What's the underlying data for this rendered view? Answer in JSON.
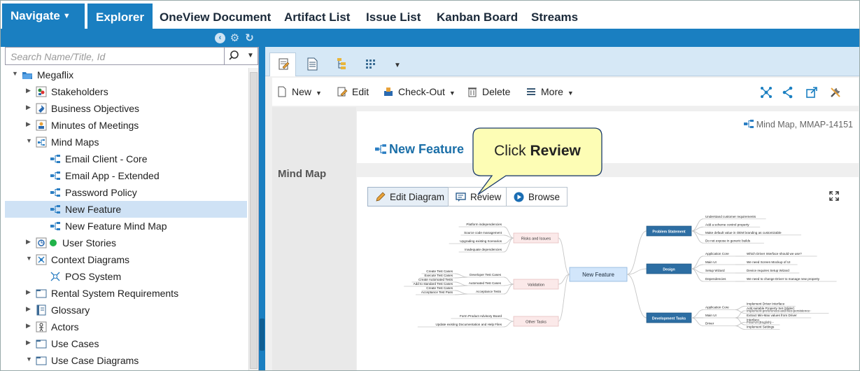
{
  "topnav": {
    "navigate": "Navigate",
    "tabs": [
      "Explorer",
      "OneView Document",
      "Artifact List",
      "Issue List",
      "Kanban Board",
      "Streams"
    ]
  },
  "search": {
    "placeholder": "Search Name/Title, Id"
  },
  "tree": [
    {
      "label": "Megaflix",
      "depth": 0,
      "arrow": "down",
      "icon": "folder-open-icon",
      "selected": false
    },
    {
      "label": "Stakeholders",
      "depth": 1,
      "arrow": "right",
      "icon": "stakeholders-icon",
      "selected": false
    },
    {
      "label": "Business Objectives",
      "depth": 1,
      "arrow": "right",
      "icon": "pin-icon",
      "selected": false
    },
    {
      "label": "Minutes of Meetings",
      "depth": 1,
      "arrow": "right",
      "icon": "meeting-icon",
      "selected": false
    },
    {
      "label": "Mind Maps",
      "depth": 1,
      "arrow": "down",
      "icon": "mind-map-folder-icon",
      "selected": false
    },
    {
      "label": "Email Client - Core",
      "depth": 2,
      "arrow": "",
      "icon": "mind-map-icon",
      "selected": false
    },
    {
      "label": "Email App - Extended",
      "depth": 2,
      "arrow": "",
      "icon": "mind-map-icon",
      "selected": false
    },
    {
      "label": "Password Policy",
      "depth": 2,
      "arrow": "",
      "icon": "mind-map-icon",
      "selected": false
    },
    {
      "label": "New Feature",
      "depth": 2,
      "arrow": "",
      "icon": "mind-map-icon",
      "selected": true
    },
    {
      "label": "New Feature Mind Map",
      "depth": 2,
      "arrow": "",
      "icon": "mind-map-icon",
      "selected": false
    },
    {
      "label": "User Stories",
      "depth": 1,
      "arrow": "right",
      "icon": "user-stories-icon",
      "selected": false,
      "status": "green-dot-icon"
    },
    {
      "label": "Context Diagrams",
      "depth": 1,
      "arrow": "down",
      "icon": "context-diagram-folder-icon",
      "selected": false
    },
    {
      "label": "POS System",
      "depth": 2,
      "arrow": "",
      "icon": "context-diagram-icon",
      "selected": false
    },
    {
      "label": "Rental System Requirements",
      "depth": 1,
      "arrow": "right",
      "icon": "folder-icon",
      "selected": false
    },
    {
      "label": "Glossary",
      "depth": 1,
      "arrow": "right",
      "icon": "glossary-icon",
      "selected": false
    },
    {
      "label": "Actors",
      "depth": 1,
      "arrow": "right",
      "icon": "actors-icon",
      "selected": false
    },
    {
      "label": "Use Cases",
      "depth": 1,
      "arrow": "right",
      "icon": "folder-icon",
      "selected": false
    },
    {
      "label": "Use Case Diagrams",
      "depth": 1,
      "arrow": "down",
      "icon": "folder-icon",
      "selected": false
    }
  ],
  "toolbar": {
    "new": "New",
    "edit": "Edit",
    "checkout": "Check-Out",
    "delete": "Delete",
    "more": "More"
  },
  "artifact": {
    "type_label": "Mind Map",
    "breadcrumb": "Mind Map, MMAP-14151",
    "title": "New Feature"
  },
  "diagram_buttons": {
    "edit": "Edit Diagram",
    "review": "Review",
    "browse": "Browse"
  },
  "callout": {
    "prefix": "Click ",
    "bold": "Review"
  },
  "mindmap": {
    "root": "New Feature",
    "left": [
      {
        "label": "Risks and Issues",
        "children": [
          "Platform independencies",
          "Source code management",
          "Upgrading existing Scenarios",
          "Inadequate dependencies"
        ]
      },
      {
        "label": "Validation",
        "children": [
          {
            "label": "Developer Test Cases",
            "children": [
              "Create Test Cases",
              "Execute Test Cases"
            ]
          },
          {
            "label": "Automated Test Cases",
            "children": [
              "Create Automated Tests",
              "Add to standard Test Cases"
            ]
          },
          {
            "label": "Acceptance Tests",
            "children": [
              "Create Test Cases",
              "Acceptance Test Pass"
            ]
          }
        ]
      },
      {
        "label": "Other Tasks",
        "children": [
          "Form Product Advisory Board",
          "Update existing Documentation and Help Files"
        ]
      }
    ],
    "right": [
      {
        "label": "Problem Statement",
        "children": [
          "Understand customer requirements",
          "Add a scheme control property",
          "Make default value in OEM branding as customizable",
          "Do not expose in generic builds"
        ]
      },
      {
        "label": "Design",
        "children": [
          {
            "label": "Application Core",
            "children": [
              "Which Driver Interface should we use?"
            ]
          },
          {
            "label": "Main UI",
            "children": [
              "We need Screen Mockup of UI"
            ]
          },
          {
            "label": "Setup Wizard",
            "children": [
              "Device requires Setup Wizard"
            ]
          },
          {
            "label": "Dependencies",
            "children": [
              "We need to change Driver to manage new property"
            ]
          }
        ]
      },
      {
        "label": "Development Tasks",
        "children": [
          {
            "label": "Application Core",
            "children": [
              "Implement Driver Interface",
              "Implement preferences and files persistence"
            ]
          },
          {
            "label": "Main UI",
            "children": [
              "Add suitable Property Set (Slider)",
              "Extract Min-Max values from Driver",
              "Final UI (English)"
            ]
          },
          {
            "label": "Driver",
            "children": [
              "Interface",
              "Implement Settings"
            ]
          }
        ]
      }
    ]
  }
}
